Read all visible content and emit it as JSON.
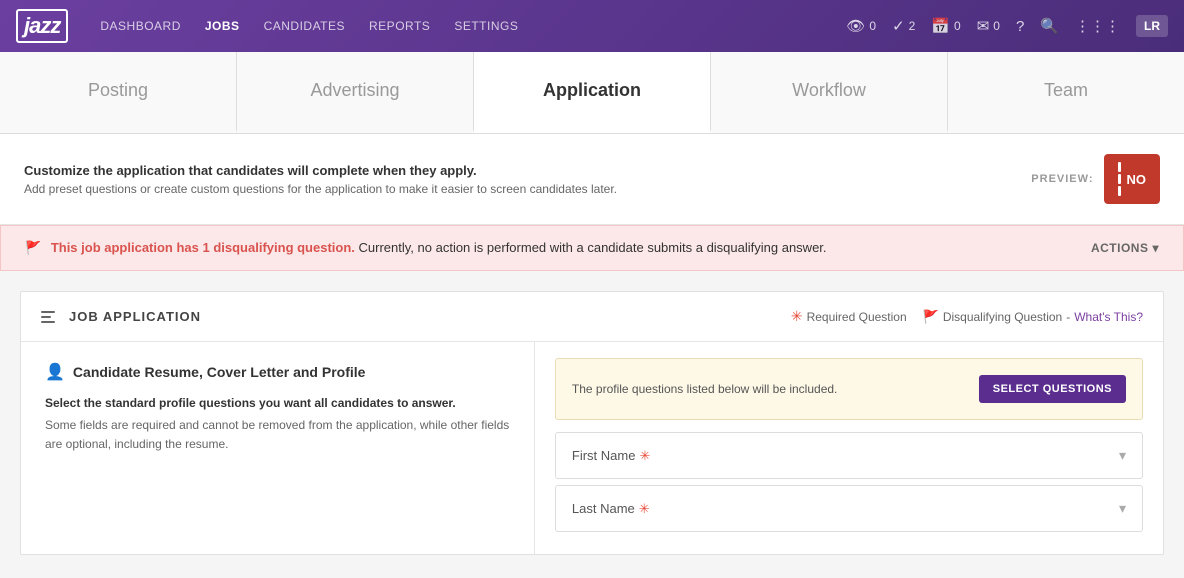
{
  "logo": "jazz",
  "nav": {
    "links": [
      {
        "label": "DASHBOARD",
        "active": false
      },
      {
        "label": "JOBS",
        "active": true
      },
      {
        "label": "CANDIDATES",
        "active": false
      },
      {
        "label": "REPORTS",
        "active": false
      },
      {
        "label": "SETTINGS",
        "active": false
      }
    ],
    "icons": [
      {
        "name": "eye-icon",
        "symbol": "👁",
        "count": "0"
      },
      {
        "name": "check-icon",
        "symbol": "✓",
        "count": "2"
      },
      {
        "name": "calendar-icon",
        "symbol": "📅",
        "count": "0"
      },
      {
        "name": "message-icon",
        "symbol": "✉",
        "count": "0"
      }
    ],
    "user": "LR"
  },
  "tabs": [
    {
      "label": "Posting",
      "active": false
    },
    {
      "label": "Advertising",
      "active": false
    },
    {
      "label": "Application",
      "active": true
    },
    {
      "label": "Workflow",
      "active": false
    },
    {
      "label": "Team",
      "active": false
    }
  ],
  "info": {
    "heading": "Customize the application that candidates will complete when they apply.",
    "description": "Add preset questions or create custom questions for the application to make it easier to screen candidates later.",
    "preview_label": "PREVIEW:",
    "preview_btn": "NO"
  },
  "warning": {
    "text_prefix": "This job application has 1 disqualifying question.",
    "text_suffix": " Currently, no action is performed with a candidate submits a disqualifying answer.",
    "actions_label": "ACTIONS"
  },
  "job_application": {
    "title": "JOB APPLICATION",
    "legend": {
      "required_label": "Required Question",
      "disqualifying_label": "Disqualifying Question",
      "whats_this": "What's This?"
    }
  },
  "left_section": {
    "heading": "Candidate Resume, Cover Letter and Profile",
    "subheading": "Select the standard profile questions you want all candidates to answer.",
    "description": "Some fields are required and cannot be removed from the application, while other fields are optional, including the resume."
  },
  "right_section": {
    "profile_box_text": "The profile questions listed below will be included.",
    "select_btn": "SELECT QUESTIONS",
    "fields": [
      {
        "label": "First Name",
        "required": true
      },
      {
        "label": "Last Name",
        "required": true
      }
    ]
  }
}
